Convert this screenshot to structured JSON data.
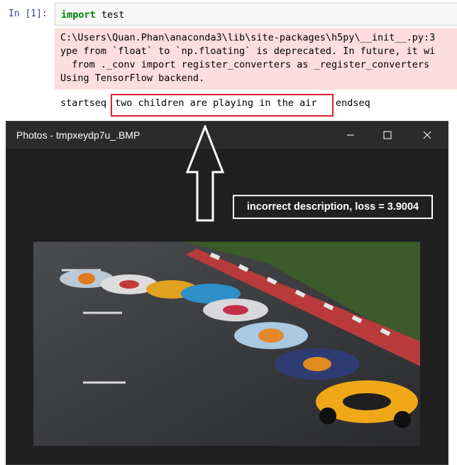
{
  "notebook": {
    "prompt": "In [1]:",
    "code_keyword": "import",
    "code_rest": " test",
    "stderr_lines": [
      "C:\\Users\\Quan.Phan\\anaconda3\\lib\\site-packages\\h5py\\__init__.py:3",
      "ype from `float` to `np.floating` is deprecated. In future, it wi",
      "  from ._conv import register_converters as _register_converters",
      "Using TensorFlow backend."
    ],
    "stdout_start": "startseq",
    "caption": "two children are playing in the air",
    "stdout_end": "endseq"
  },
  "photos_window": {
    "title": "Photos - tmpxeydp7u_.BMP",
    "minimize": "—",
    "maximize": "☐",
    "close": "✕"
  },
  "annotation": {
    "label": "incorrect description, loss = 3.9004"
  },
  "colors": {
    "stderr_bg": "#fddddd",
    "highlight_red": "#e0202a",
    "window_bg": "#202020",
    "prompt_blue": "#303f9f",
    "keyword_green": "#008000"
  }
}
